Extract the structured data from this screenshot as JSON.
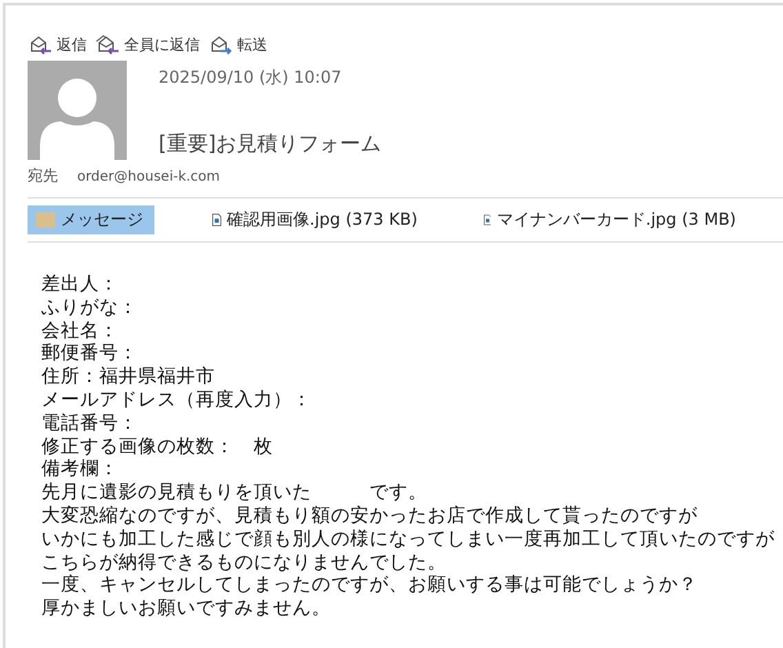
{
  "toolbar": [
    {
      "kind": "reply",
      "label": "返信"
    },
    {
      "kind": "reply_all",
      "label": "全員に返信"
    },
    {
      "kind": "forward",
      "label": "転送"
    }
  ],
  "header": {
    "date": "2025/09/10 (水) 10:07",
    "subject": "[重要]お見積りフォーム",
    "to_label": "宛先",
    "to": "order@housei-k.com"
  },
  "attachments": [
    {
      "kind": "message",
      "label": "メッセージ",
      "selected": true
    },
    {
      "kind": "file",
      "label": "確認用画像.jpg (373 KB)",
      "selected": false
    },
    {
      "kind": "file",
      "label": "マイナンバーカード.jpg (3 MB)",
      "selected": false
    }
  ],
  "body": [
    "差出人：",
    "ふりがな：",
    "会社名：",
    "郵便番号：",
    "住所：福井県福井市",
    "メールアドレス（再度入力）：",
    "電話番号：",
    "修正する画像の枚数：　枚",
    "備考欄：",
    "先月に遺影の見積もりを頂いた　　　です。",
    "大変恐縮なのですが、見積もり額の安かったお店で作成して貰ったのですが",
    "いかにも加工した感じで顔も別人の様になってしまい一度再加工して頂いたのですが",
    "こちらが納得できるものになりませんでした。",
    "一度、キャンセルしてしまったのですが、お願いする事は可能でしょうか？",
    "厚かましいお願いですみません。"
  ]
}
